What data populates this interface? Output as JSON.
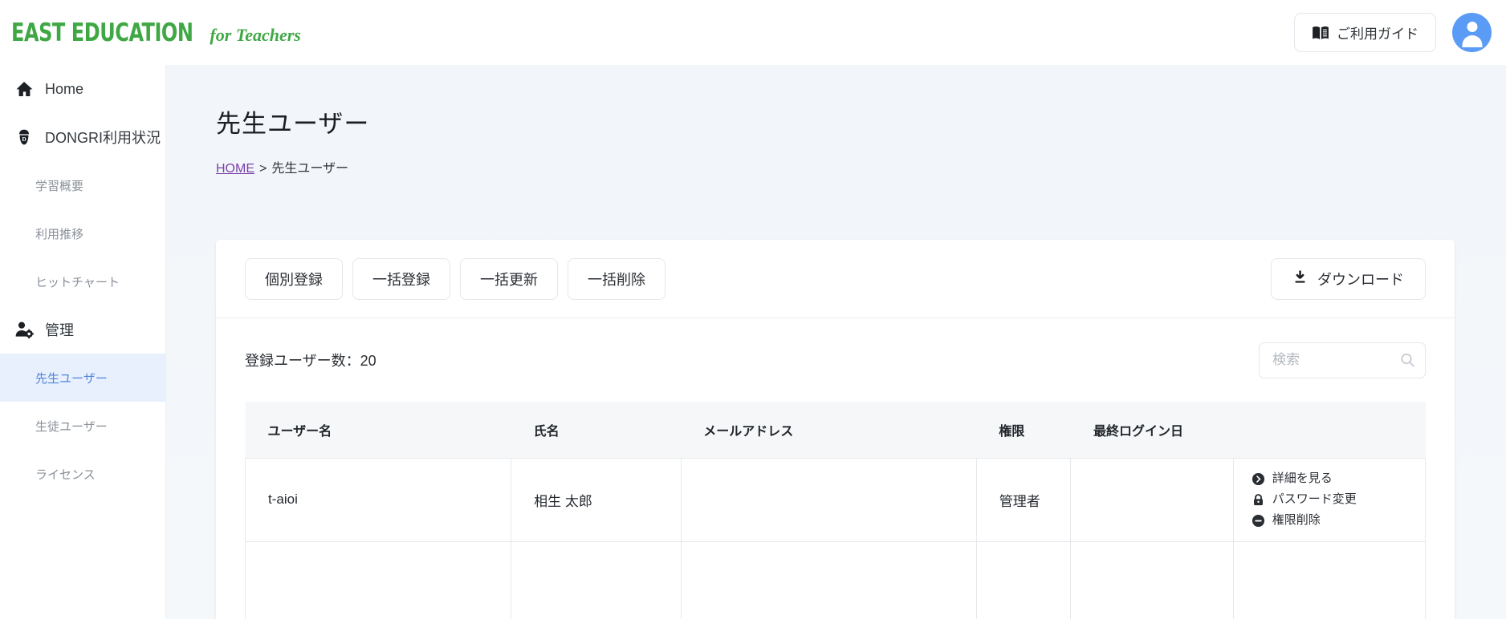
{
  "header": {
    "brand_main": "EAST EDUCATION",
    "brand_sub": "for Teachers",
    "guide_button": "ご利用ガイド",
    "guide_icon": "book-icon",
    "avatar_icon": "user-avatar-icon"
  },
  "sidebar": {
    "items": [
      {
        "label": "Home",
        "icon": "home-icon",
        "level": "top",
        "active": false
      },
      {
        "label": "DONGRI利用状況",
        "icon": "dongri-icon",
        "level": "top",
        "active": false
      },
      {
        "label": "学習概要",
        "icon": "",
        "level": "sub",
        "active": false
      },
      {
        "label": "利用推移",
        "icon": "",
        "level": "sub",
        "active": false
      },
      {
        "label": "ヒットチャート",
        "icon": "",
        "level": "sub",
        "active": false
      },
      {
        "label": "管理",
        "icon": "user-settings-icon",
        "level": "top",
        "active": false
      },
      {
        "label": "先生ユーザー",
        "icon": "",
        "level": "sub",
        "active": true
      },
      {
        "label": "生徒ユーザー",
        "icon": "",
        "level": "sub",
        "active": false
      },
      {
        "label": "ライセンス",
        "icon": "",
        "level": "sub",
        "active": false
      }
    ]
  },
  "page": {
    "title": "先生ユーザー",
    "breadcrumb_home": "HOME",
    "breadcrumb_sep": ">",
    "breadcrumb_current": "先生ユーザー"
  },
  "toolbar": {
    "buttons": [
      {
        "label": "個別登録"
      },
      {
        "label": "一括登録"
      },
      {
        "label": "一括更新"
      },
      {
        "label": "一括削除"
      }
    ],
    "download_label": "ダウンロード",
    "download_icon": "download-icon"
  },
  "list": {
    "count_label": "登録ユーザー数：20",
    "search_placeholder": "検索",
    "search_value": "",
    "search_icon": "search-icon",
    "columns": [
      "ユーザー名",
      "氏名",
      "メールアドレス",
      "権限",
      "最終ログイン日",
      ""
    ],
    "rows": [
      {
        "username": "t-aioi",
        "fullname": "相生 太郎",
        "email": "",
        "role": "管理者",
        "last_login": "",
        "actions": [
          {
            "label": "詳細を見る",
            "icon": "chevron-right-circle-icon"
          },
          {
            "label": "パスワード変更",
            "icon": "lock-icon"
          },
          {
            "label": "権限削除",
            "icon": "minus-circle-icon"
          }
        ]
      },
      {
        "username": "",
        "fullname": "",
        "email": "",
        "role": "",
        "last_login": "",
        "actions": []
      }
    ]
  },
  "colors": {
    "brand_green": "#3fa845",
    "accent_blue": "#5186d6",
    "avatar_blue": "#5a9bf6",
    "link_purple": "#7a3fa8",
    "main_bg": "#f2f6fa"
  }
}
